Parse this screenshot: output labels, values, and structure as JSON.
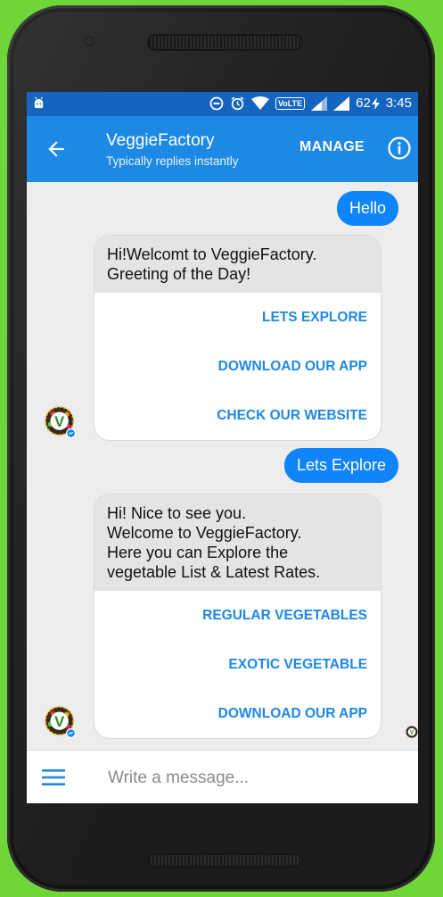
{
  "status_bar": {
    "battery": "62",
    "time": "3:45",
    "network_badge": "VoLTE"
  },
  "header": {
    "title": "VeggieFactory",
    "subtitle": "Typically replies instantly",
    "manage_label": "MANAGE"
  },
  "messages": {
    "out_1": "Hello",
    "card_1": {
      "text_lines": [
        "Hi!Welcomt to VeggieFactory.",
        "Greeting of the Day!"
      ],
      "buttons": [
        "LETS EXPLORE",
        "DOWNLOAD OUR APP",
        "CHECK OUR WEBSITE"
      ]
    },
    "out_2": "Lets Explore",
    "card_2": {
      "text_lines": [
        "Hi! Nice to see you.",
        "Welcome to VeggieFactory.",
        "Here you can Explore the",
        "vegetable List & Latest Rates."
      ],
      "buttons": [
        "REGULAR VEGETABLES",
        "EXOTIC VEGETABLE",
        "DOWNLOAD OUR APP"
      ]
    }
  },
  "composer": {
    "placeholder": "Write a message..."
  },
  "colors": {
    "background": "#6fd63a",
    "status_bar": "#1565c0",
    "app_bar": "#1e88e5",
    "outgoing_bubble": "#0f84fb",
    "action_text": "#1e88e5"
  },
  "icons": [
    "android-icon",
    "do-not-disturb-icon",
    "alarm-icon",
    "wifi-icon",
    "signal-icon",
    "battery-charging-icon",
    "back-arrow-icon",
    "info-icon",
    "avatar-logo",
    "messenger-badge-icon",
    "menu-icon"
  ]
}
